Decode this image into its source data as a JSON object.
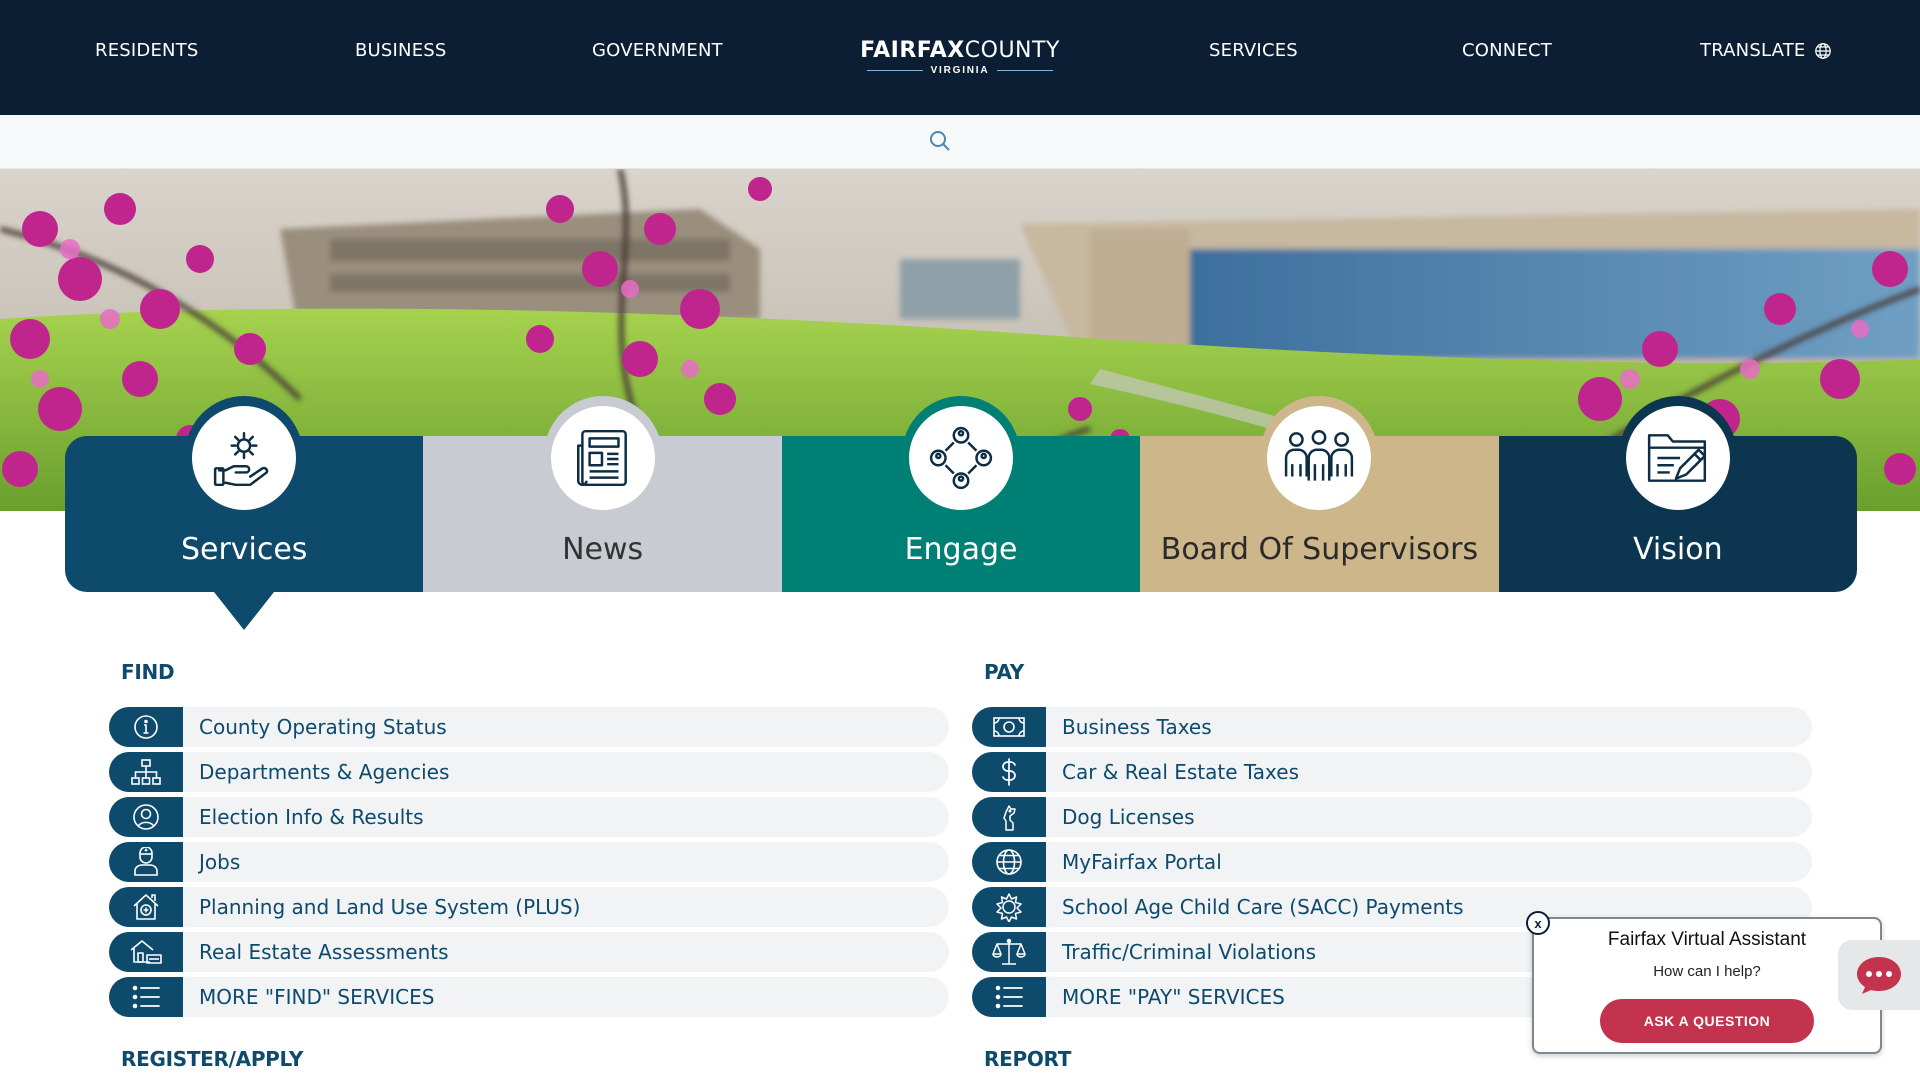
{
  "nav": {
    "left": [
      "RESIDENTS",
      "BUSINESS",
      "GOVERNMENT"
    ],
    "right": [
      "SERVICES",
      "CONNECT"
    ],
    "translate": "TRANSLATE",
    "logo_bold": "FAIRFAX",
    "logo_light": "COUNTY",
    "logo_sub": "VIRGINIA"
  },
  "tabs": {
    "services": "Services",
    "news": "News",
    "engage": "Engage",
    "board": "Board Of Supervisors",
    "vision": "Vision"
  },
  "find": {
    "title": "FIND",
    "items": [
      "County Operating Status",
      "Departments & Agencies",
      "Election Info & Results",
      "Jobs",
      "Planning and Land Use System (PLUS)",
      "Real Estate Assessments",
      "MORE \"FIND\" SERVICES"
    ],
    "icons": [
      "info-icon",
      "org-chart-icon",
      "user-circle-icon",
      "person-badge-icon",
      "house-plus-icon",
      "house-assessment-icon",
      "list-icon"
    ]
  },
  "pay": {
    "title": "PAY",
    "items": [
      "Business Taxes",
      "Car & Real Estate Taxes",
      "Dog Licenses",
      "MyFairfax Portal",
      "School Age Child Care (SACC) Payments",
      "Traffic/Criminal Violations",
      "MORE \"PAY\" SERVICES"
    ],
    "icons": [
      "cash-icon",
      "dollar-icon",
      "dog-icon",
      "globe-icon",
      "sun-icon",
      "scales-icon",
      "list-icon"
    ]
  },
  "register_title": "REGISTER/APPLY",
  "report_title": "REPORT",
  "assistant": {
    "title": "Fairfax Virtual Assistant",
    "subtitle": "How can I help?",
    "button": "ASK A QUESTION",
    "close": "x"
  },
  "colors": {
    "navy": "#0c1e33",
    "services": "#0e4a6b",
    "news": "#c8ccd2",
    "engage": "#007f74",
    "board": "#cdb68a",
    "vision": "#0c3550",
    "ask_button": "#c4334e"
  }
}
